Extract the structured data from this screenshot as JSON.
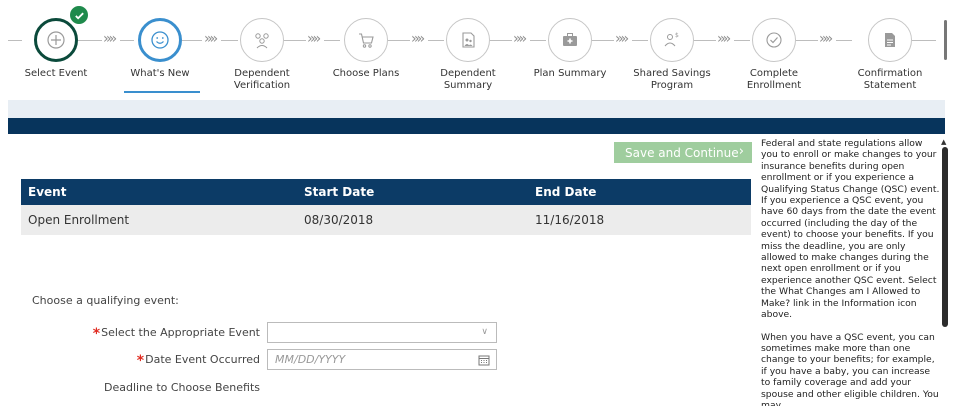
{
  "stepper": {
    "steps": [
      {
        "label": "Select Event",
        "icon": "plus-circle-icon",
        "state": "done"
      },
      {
        "label": "What's New",
        "icon": "smiley-icon",
        "state": "active"
      },
      {
        "label": "Dependent Verification",
        "icon": "people-icon",
        "state": "pending"
      },
      {
        "label": "Choose Plans",
        "icon": "cart-icon",
        "state": "pending"
      },
      {
        "label": "Dependent Summary",
        "icon": "family-document-icon",
        "state": "pending"
      },
      {
        "label": "Plan Summary",
        "icon": "medical-kit-icon",
        "state": "pending"
      },
      {
        "label": "Shared Savings Program",
        "icon": "person-dollar-icon",
        "state": "pending"
      },
      {
        "label": "Complete Enrollment",
        "icon": "check-circle-icon",
        "state": "pending"
      },
      {
        "label": "Confirmation Statement",
        "icon": "document-icon",
        "state": "pending"
      }
    ],
    "chevrons": "»»"
  },
  "actions": {
    "save_continue": "Save and Continue",
    "save_arrow": "›"
  },
  "events_table": {
    "headers": [
      "Event",
      "Start Date",
      "End Date"
    ],
    "rows": [
      [
        "Open Enrollment",
        "08/30/2018",
        "11/16/2018"
      ]
    ]
  },
  "form": {
    "intro": "Choose a qualifying event:",
    "event_label": "Select the Appropriate Event",
    "event_value": "",
    "date_label": "Date Event Occurred",
    "date_placeholder": "MM/DD/YYYY",
    "deadline_label": "Deadline to Choose Benefits",
    "required_mark": "*"
  },
  "help": {
    "paragraphs": [
      "Federal and state regulations allow you to enroll or make changes to your insurance benefits during open enrollment or if you experience a Qualifying Status Change (QSC) event. If you experience a QSC event, you have 60 days from the date the event occurred (including the day of the event) to choose your benefits. If you miss the deadline, you are only allowed to make changes during the next open enrollment or if you experience another QSC event. Select the What Changes am I Allowed to Make? link in the Information icon above.",
      "When you have a QSC event, you can sometimes make more than one change to your benefits; for example, if you have a baby, you can increase to family coverage and add your spouse and other eligible children. You may"
    ]
  },
  "colors": {
    "done": "#0b4a3b",
    "active": "#3a8fce",
    "check": "#1f8a4c",
    "navy": "#07345c",
    "table_header": "#0c3b66",
    "save_button": "#9fcd9e",
    "required": "#e02b20"
  }
}
